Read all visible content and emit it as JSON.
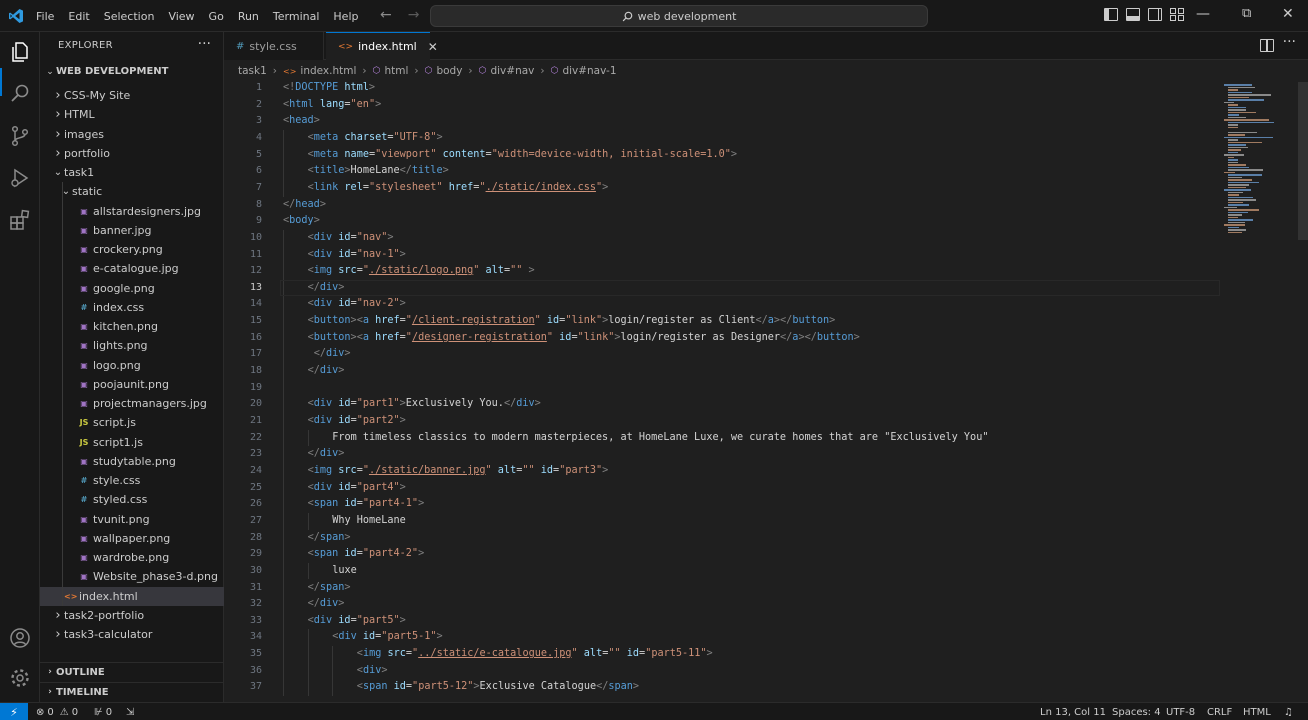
{
  "menu": [
    "File",
    "Edit",
    "Selection",
    "View",
    "Go",
    "Run",
    "Terminal",
    "Help"
  ],
  "command_center": "web development",
  "explorer": {
    "title": "EXPLORER",
    "folder": "WEB DEVELOPMENT",
    "items": [
      {
        "label": "CSS-My Site",
        "level": 1,
        "kind": "folder",
        "open": false
      },
      {
        "label": "HTML",
        "level": 1,
        "kind": "folder",
        "open": false
      },
      {
        "label": "images",
        "level": 1,
        "kind": "folder",
        "open": false
      },
      {
        "label": "portfolio",
        "level": 1,
        "kind": "folder",
        "open": false
      },
      {
        "label": "task1",
        "level": 1,
        "kind": "folder",
        "open": true
      },
      {
        "label": "static",
        "level": 2,
        "kind": "folder",
        "open": true
      },
      {
        "label": "allstardesigners.jpg",
        "level": 3,
        "kind": "image"
      },
      {
        "label": "banner.jpg",
        "level": 3,
        "kind": "image"
      },
      {
        "label": "crockery.png",
        "level": 3,
        "kind": "image"
      },
      {
        "label": "e-catalogue.jpg",
        "level": 3,
        "kind": "image"
      },
      {
        "label": "google.png",
        "level": 3,
        "kind": "image"
      },
      {
        "label": "index.css",
        "level": 3,
        "kind": "css"
      },
      {
        "label": "kitchen.png",
        "level": 3,
        "kind": "image"
      },
      {
        "label": "lights.png",
        "level": 3,
        "kind": "image"
      },
      {
        "label": "logo.png",
        "level": 3,
        "kind": "image"
      },
      {
        "label": "poojaunit.png",
        "level": 3,
        "kind": "image"
      },
      {
        "label": "projectmanagers.jpg",
        "level": 3,
        "kind": "image"
      },
      {
        "label": "script.js",
        "level": 3,
        "kind": "js"
      },
      {
        "label": "script1.js",
        "level": 3,
        "kind": "js"
      },
      {
        "label": "studytable.png",
        "level": 3,
        "kind": "image"
      },
      {
        "label": "style.css",
        "level": 3,
        "kind": "css"
      },
      {
        "label": "styled.css",
        "level": 3,
        "kind": "css"
      },
      {
        "label": "tvunit.png",
        "level": 3,
        "kind": "image"
      },
      {
        "label": "wallpaper.png",
        "level": 3,
        "kind": "image"
      },
      {
        "label": "wardrobe.png",
        "level": 3,
        "kind": "image"
      },
      {
        "label": "Website_phase3-d.png",
        "level": 3,
        "kind": "image"
      },
      {
        "label": "index.html",
        "level": 2,
        "kind": "html",
        "selected": true
      },
      {
        "label": "task2-portfolio",
        "level": 1,
        "kind": "folder",
        "open": false
      },
      {
        "label": "task3-calculator",
        "level": 1,
        "kind": "folder",
        "open": false
      }
    ],
    "outline": "OUTLINE",
    "timeline": "TIMELINE"
  },
  "tabs": [
    {
      "label": "style.css",
      "active": false,
      "icon": "#"
    },
    {
      "label": "index.html",
      "active": true,
      "icon": "<>"
    }
  ],
  "breadcrumb": [
    "task1",
    "index.html",
    "html",
    "body",
    "div#nav",
    "div#nav-1"
  ],
  "editor": {
    "current_line": 13,
    "lines": [
      {
        "n": 1,
        "indent": 0,
        "code": "<!DOCTYPE html>"
      },
      {
        "n": 2,
        "indent": 0,
        "code": "<html lang=\"en\">"
      },
      {
        "n": 3,
        "indent": 0,
        "code": "<head>"
      },
      {
        "n": 4,
        "indent": 1,
        "code": "<meta charset=\"UTF-8\">"
      },
      {
        "n": 5,
        "indent": 1,
        "code": "<meta name=\"viewport\" content=\"width=device-width, initial-scale=1.0\">"
      },
      {
        "n": 6,
        "indent": 1,
        "code": "<title>HomeLane</title>"
      },
      {
        "n": 7,
        "indent": 1,
        "code": "<link rel=\"stylesheet\" href=\"./static/index.css\">"
      },
      {
        "n": 8,
        "indent": 0,
        "code": "</head>"
      },
      {
        "n": 9,
        "indent": 0,
        "code": "<body>"
      },
      {
        "n": 10,
        "indent": 1,
        "code": "<div id=\"nav\">"
      },
      {
        "n": 11,
        "indent": 1,
        "code": "<div id=\"nav-1\">"
      },
      {
        "n": 12,
        "indent": 1,
        "code": "<img src=\"./static/logo.png\" alt=\"\" >"
      },
      {
        "n": 13,
        "indent": 1,
        "code": "</div>"
      },
      {
        "n": 14,
        "indent": 1,
        "code": "<div id=\"nav-2\">"
      },
      {
        "n": 15,
        "indent": 1,
        "code": "<button><a href=\"/client-registration\" id=\"link\">login/register as Client</a></button>"
      },
      {
        "n": 16,
        "indent": 1,
        "code": "<button><a href=\"/designer-registration\" id=\"link\">login/register as Designer</a></button>"
      },
      {
        "n": 17,
        "indent": 1,
        "code": " </div>"
      },
      {
        "n": 18,
        "indent": 1,
        "code": "</div>"
      },
      {
        "n": 19,
        "indent": 0,
        "code": ""
      },
      {
        "n": 20,
        "indent": 1,
        "code": "<div id=\"part1\">Exclusively You.</div>"
      },
      {
        "n": 21,
        "indent": 1,
        "code": "<div id=\"part2\">"
      },
      {
        "n": 22,
        "indent": 2,
        "code": "From timeless classics to modern masterpieces, at HomeLane Luxe, we curate homes that are \"Exclusively You\""
      },
      {
        "n": 23,
        "indent": 1,
        "code": "</div>"
      },
      {
        "n": 24,
        "indent": 1,
        "code": "<img src=\"./static/banner.jpg\" alt=\"\" id=\"part3\">"
      },
      {
        "n": 25,
        "indent": 1,
        "code": "<div id=\"part4\">"
      },
      {
        "n": 26,
        "indent": 1,
        "code": "<span id=\"part4-1\">"
      },
      {
        "n": 27,
        "indent": 2,
        "code": "Why HomeLane"
      },
      {
        "n": 28,
        "indent": 1,
        "code": "</span>"
      },
      {
        "n": 29,
        "indent": 1,
        "code": "<span id=\"part4-2\">"
      },
      {
        "n": 30,
        "indent": 2,
        "code": "luxe"
      },
      {
        "n": 31,
        "indent": 1,
        "code": "</span>"
      },
      {
        "n": 32,
        "indent": 1,
        "code": "</div>"
      },
      {
        "n": 33,
        "indent": 1,
        "code": "<div id=\"part5\">"
      },
      {
        "n": 34,
        "indent": 2,
        "code": "<div id=\"part5-1\">"
      },
      {
        "n": 35,
        "indent": 3,
        "code": "<img src=\"../static/e-catalogue.jpg\" alt=\"\" id=\"part5-11\">"
      },
      {
        "n": 36,
        "indent": 3,
        "code": "<div>"
      },
      {
        "n": 37,
        "indent": 3,
        "code": "<span id=\"part5-12\">Exclusive Catalogue</span>"
      }
    ]
  },
  "status": {
    "errors": "0",
    "warnings": "0",
    "ports": "0",
    "position": "Ln 13, Col 11",
    "spaces": "Spaces: 4",
    "encoding": "UTF-8",
    "eol": "CRLF",
    "language": "HTML"
  },
  "colors": {
    "accent": "#0078d4",
    "tag": "#569cd6",
    "attr_name": "#9cdcfe",
    "attr_value": "#ce9178",
    "punct": "#808080",
    "css_icon": "#519aba",
    "js_icon": "#cbcb41",
    "html_icon": "#e37933",
    "image_icon": "#a074c4"
  }
}
